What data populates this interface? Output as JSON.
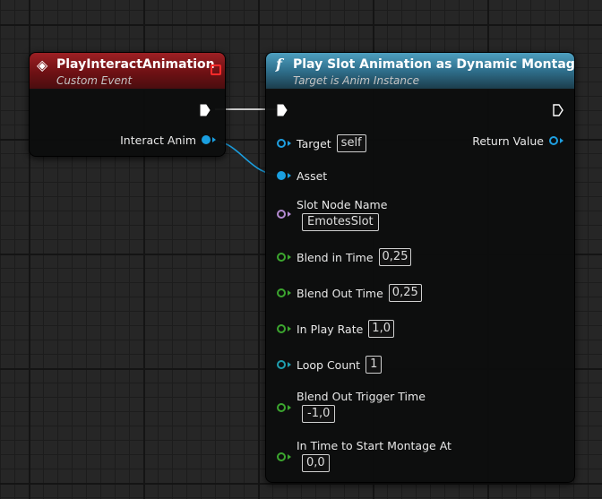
{
  "event_node": {
    "title": "PlayInteractAnimation",
    "subtitle": "Custom Event",
    "output_pin_label": "Interact Anim"
  },
  "function_node": {
    "title": "Play Slot Animation as Dynamic Montage",
    "subtitle": "Target is Anim Instance",
    "pins": {
      "target": {
        "label": "Target",
        "value": "self"
      },
      "asset": {
        "label": "Asset"
      },
      "slot_node_name": {
        "label": "Slot Node Name",
        "value": "EmotesSlot"
      },
      "blend_in_time": {
        "label": "Blend in Time",
        "value": "0,25"
      },
      "blend_out_time": {
        "label": "Blend Out Time",
        "value": "0,25"
      },
      "in_play_rate": {
        "label": "In Play Rate",
        "value": "1,0"
      },
      "loop_count": {
        "label": "Loop Count",
        "value": "1"
      },
      "blend_out_trigger_time": {
        "label": "Blend Out Trigger Time",
        "value": "-1,0"
      },
      "in_time_to_start": {
        "label": "In Time to Start Montage At",
        "value": "0,0"
      }
    },
    "return_value_label": "Return Value"
  },
  "colors": {
    "object_pin": "#1a9fe0",
    "interface_pin": "#1f7fb5",
    "name_pin": "#b38ad1",
    "float_pin": "#3ca62f",
    "int_pin": "#1f9fb0",
    "event_header": "#8a1a1d",
    "function_header": "#3f86a6"
  }
}
